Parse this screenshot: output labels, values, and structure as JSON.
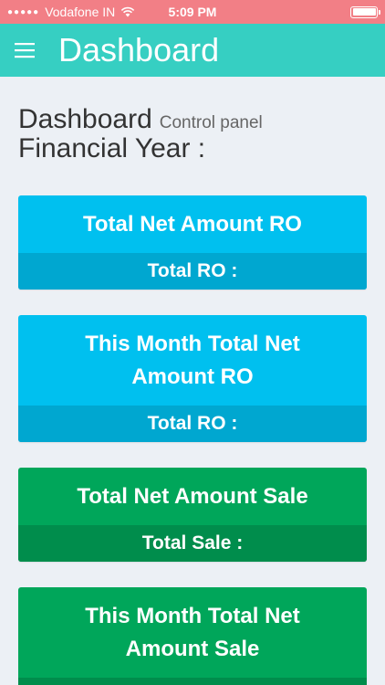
{
  "status_bar": {
    "signal": "●●●●●",
    "carrier": "Vodafone IN",
    "time": "5:09 PM"
  },
  "header": {
    "menu_icon": "hamburger-menu-icon",
    "title": "Dashboard"
  },
  "page": {
    "title": "Dashboard",
    "subtitle": "Control panel",
    "financial_year_label": "Financial Year :"
  },
  "cards": [
    {
      "title": "Total Net Amount RO",
      "footer": "Total RO :",
      "color": "#00c0ef"
    },
    {
      "title": "This Month Total Net Amount RO",
      "footer": "Total RO :",
      "color": "#00c0ef"
    },
    {
      "title": "Total Net Amount Sale",
      "footer": "Total Sale :",
      "color": "#00a65a"
    },
    {
      "title": "This Month Total Net Amount Sale",
      "footer": "",
      "color": "#00a65a"
    }
  ],
  "colors": {
    "status_bar": "#f27f86",
    "header": "#36cfc2",
    "background": "#ecf0f5",
    "aqua": "#00c0ef",
    "green": "#00a65a"
  }
}
